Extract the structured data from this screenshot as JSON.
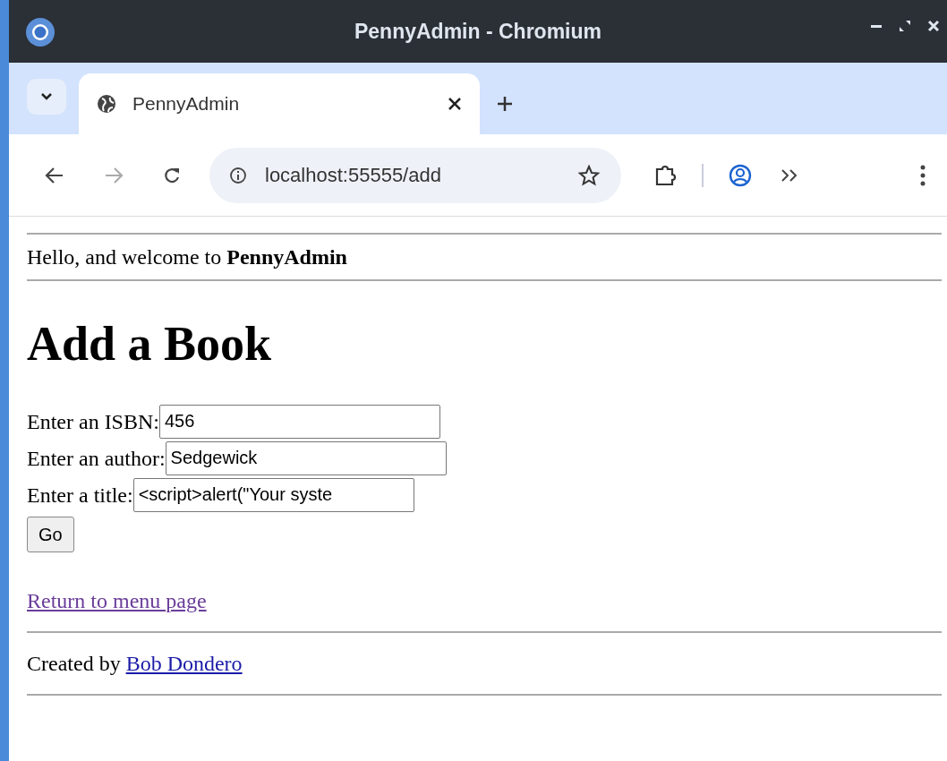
{
  "window": {
    "title": "PennyAdmin - Chromium"
  },
  "tabs": [
    {
      "label": "PennyAdmin",
      "selected": true
    }
  ],
  "address_bar": {
    "url": "localhost:55555/add"
  },
  "page": {
    "greeting": "Hello, and welcome to **PennyAdmin**",
    "heading": "Add a Book",
    "fields": [
      {
        "label": "Enter an ISBN:",
        "value": "456"
      },
      {
        "label": "Enter an author:",
        "value": "Sedgewick"
      },
      {
        "label": "Enter a title:",
        "value": "<script>alert(\"Your syste"
      }
    ],
    "submit": "Go",
    "return_link": "Return to menu page",
    "footer_prefix": "Created by",
    "footer_link": "Bob Dondero"
  }
}
